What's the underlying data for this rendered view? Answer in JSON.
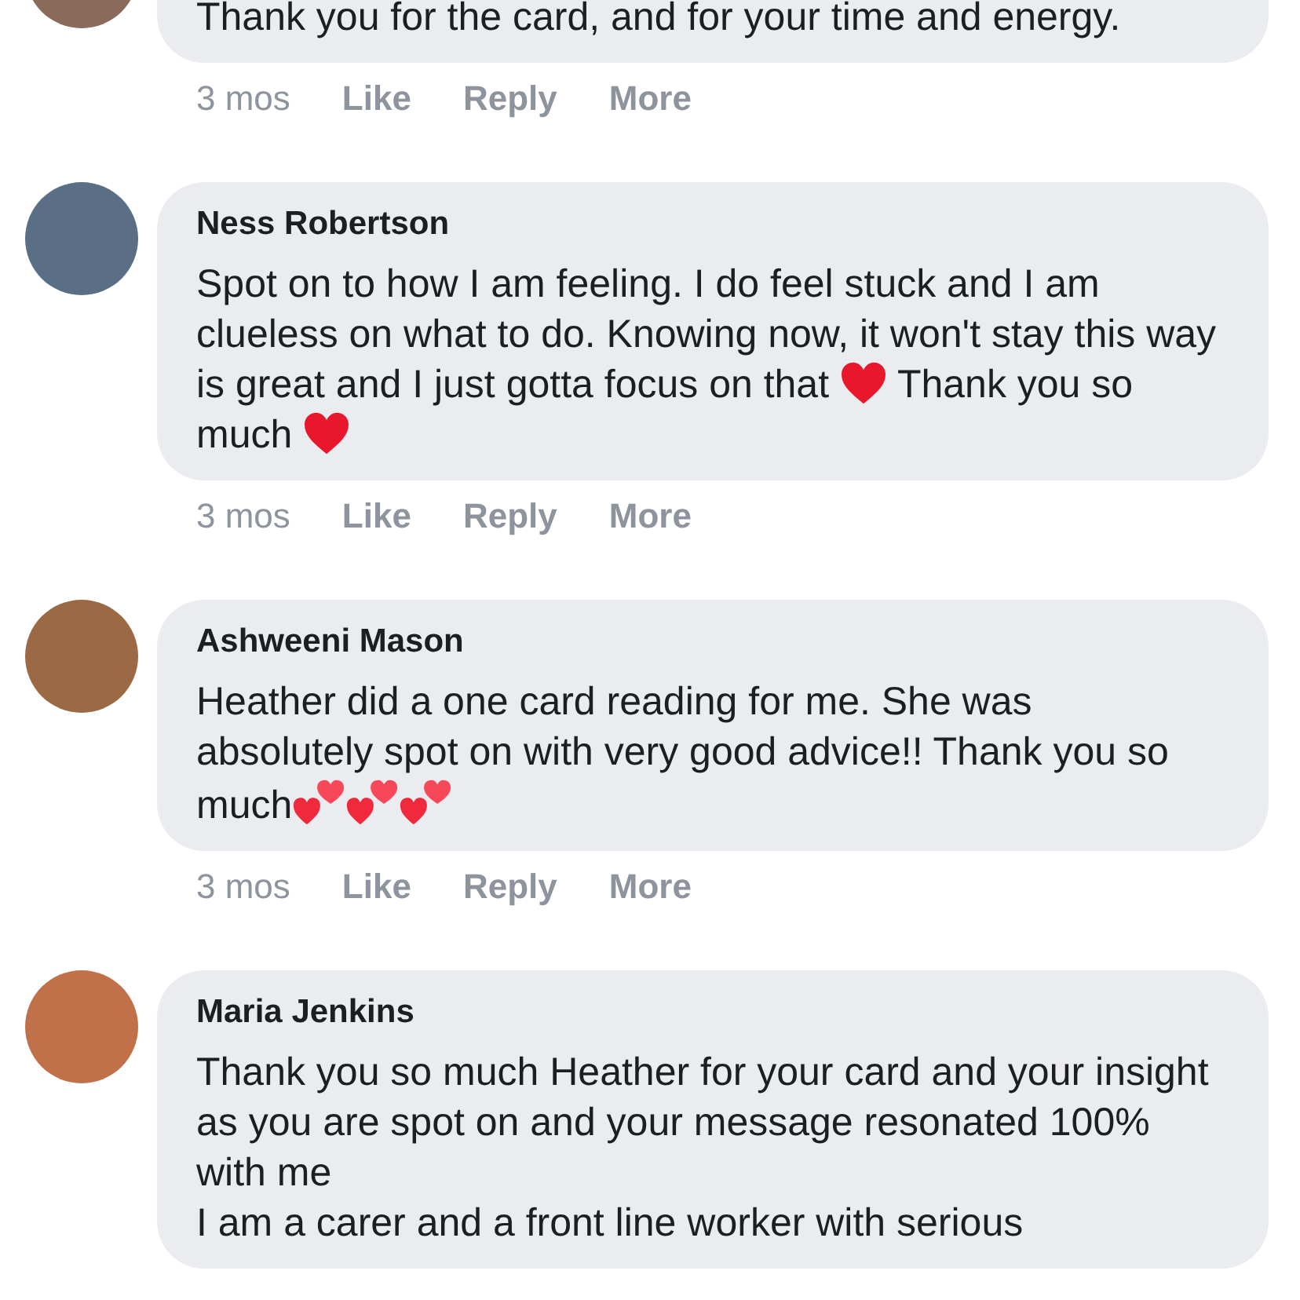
{
  "comments": [
    {
      "body": [
        {
          "kind": "text",
          "text": "Thank you for the card, and for your time and energy."
        }
      ],
      "time": "3 mos",
      "actions": [
        "Like",
        "Reply",
        "More"
      ]
    },
    {
      "author": "Ness Robertson",
      "body": [
        {
          "kind": "text",
          "text": "Spot on to how I am feeling. I do feel stuck and I am clueless on what to do. Knowing now, it won't stay this way is great and I just gotta focus on that "
        },
        {
          "kind": "heart"
        },
        {
          "kind": "text",
          "text": " Thank you so much "
        },
        {
          "kind": "heart"
        }
      ],
      "time": "3 mos",
      "actions": [
        "Like",
        "Reply",
        "More"
      ]
    },
    {
      "author": "Ashweeni Mason",
      "body": [
        {
          "kind": "text",
          "text": "Heather did a one card reading for me. She was absolutely spot on with very good advice!! Thank you so much"
        },
        {
          "kind": "two-hearts"
        },
        {
          "kind": "two-hearts"
        },
        {
          "kind": "two-hearts"
        }
      ],
      "time": "3 mos",
      "actions": [
        "Like",
        "Reply",
        "More"
      ]
    },
    {
      "author": "Maria Jenkins",
      "body": [
        {
          "kind": "text",
          "text": "Thank you so much Heather for your card and your insight as you are spot on and your message resonated 100% with me"
        },
        {
          "kind": "break"
        },
        {
          "kind": "text",
          "text": "I am a carer and a front line worker with serious"
        }
      ]
    }
  ]
}
